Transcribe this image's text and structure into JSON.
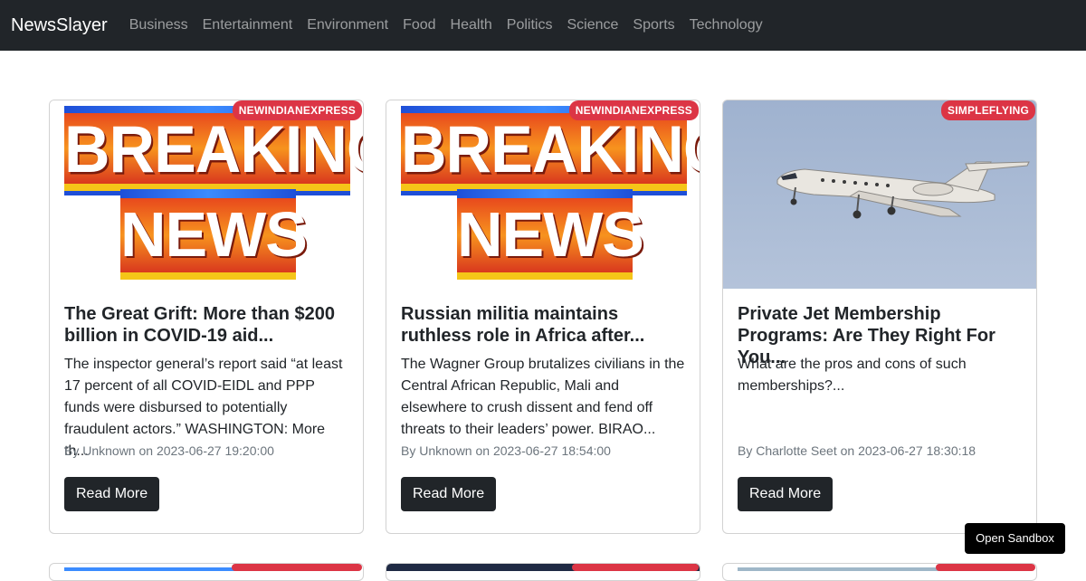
{
  "navbar": {
    "brand": "NewsSlayer",
    "links": [
      "Business",
      "Entertainment",
      "Environment",
      "Food",
      "Health",
      "Politics",
      "Science",
      "Sports",
      "Technology"
    ]
  },
  "articles": [
    {
      "source": "NEWINDIANEXPRESS",
      "image": "breaking-news",
      "image_text": [
        "BREAKING",
        "NEWS"
      ],
      "title": "The Great Grift: More than $200 billion in COVID-19 aid...",
      "description": "The inspector general’s report said “at least 17 percent of all COVID-EIDL and PPP funds were disbursed to potentially fraudulent actors.” WASHINGTON: More th...",
      "meta": "By Unknown on 2023-06-27 19:20:00",
      "button": "Read More"
    },
    {
      "source": "NEWINDIANEXPRESS",
      "image": "breaking-news",
      "image_text": [
        "BREAKING",
        "NEWS"
      ],
      "title": "Russian militia maintains ruthless role in Africa after...",
      "description": "The Wagner Group brutalizes civilians in the Central African Republic, Mali and elsewhere to crush dissent and fend off threats to their leaders’ power. BIRAO...",
      "meta": "By Unknown on 2023-06-27 18:54:00",
      "button": "Read More"
    },
    {
      "source": "SIMPLEFLYING",
      "image": "private-jet",
      "title": "Private Jet Membership Programs: Are They Right For You...",
      "description": "What are the pros and cons of such memberships?...",
      "meta": "By Charlotte Seet on 2023-06-27 18:30:18",
      "button": "Read More"
    }
  ],
  "sandbox_button": "Open Sandbox",
  "colors": {
    "navbar": "#212529",
    "badge": "#dc3545",
    "button": "#212529"
  }
}
